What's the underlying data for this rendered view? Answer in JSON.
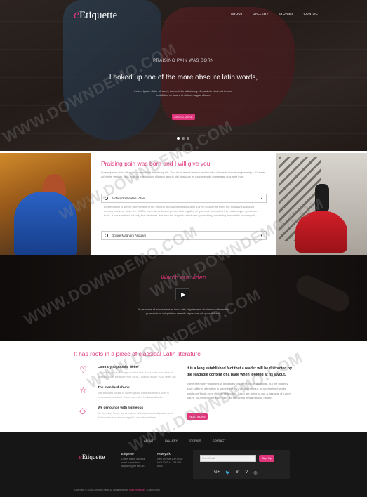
{
  "brand": {
    "logo_initial": "e",
    "logo_text": "Etiquette",
    "accent": "#e0357a"
  },
  "nav": [
    "ABOUT",
    "GALLERY",
    "STORIES",
    "CONTACT"
  ],
  "hero": {
    "kicker": "PRAISING PAIN WAS BORN",
    "title": "Looked up one of the more obscure latin words,",
    "subtitle_1": "Lorem ipsum dolor sit amet, consectetur adipiscing elit, sed do eiusmod tempor",
    "subtitle_2": "incididunt ut labore et dolore magna aliqua.",
    "button": "LEARN MORE",
    "slides": 3
  },
  "panel": {
    "title": "Praising pain was born and I will give you",
    "text": "Lorem ipsum dolor sit amet, consectetur adipiscing elit. Sed do eiusmod tempor incididunt ut labore et dolore magna aliqua. Ut enim ad minim veniam, quis nostrud exercitation ullamco laboris nisi ut aliquip ex ea commodo consequat duis aute irure.",
    "accordion": [
      {
        "label": "Architecto Beatae Vitae",
        "open": true
      },
      {
        "label": "Dolore Magnam Aliquam",
        "open": false
      }
    ],
    "accordion_body": "Lorem ipsum is simply dummy text of the printing and typesetting industry. Lorem Ipsum has been the industry's standard dummy text ever since the 1500s, when an unknown printer took a galley of type and scrambled it to make a type specimen book. It has survived not only five centuries, but also the leap into electronic typesetting, remaining essentially unchanged."
  },
  "video": {
    "title": "Watch our video",
    "play_icon": "play-icon",
    "text": "At vero eos et accusamus et iusto odio dignissimos ducimus qui blanditiis praesentium voluptatum deleniti atque corrupti quos dolores."
  },
  "features": {
    "title": "It has roots in a piece of classical Latin literature",
    "items": [
      {
        "icon": "heart-icon",
        "heading": "Contrary to popular belief",
        "text": "Lorem ipsum is not simply random text. It has roots in a piece of classical Latin literature from 45 BC, making it over 2000 years old."
      },
      {
        "icon": "star-icon",
        "heading": "The standard chunk",
        "text": "The standard chunk of Lorem Ipsum used since the 1500s is reproduced below for those interested in classical texts."
      },
      {
        "icon": "diamond-icon",
        "heading": "We denounce with righteous",
        "text": "On the other hand, we denounce with righteous indignation and dislike men who are so beguiled and demoralized."
      }
    ],
    "right_heading": "It is a long established fact that a reader will be distracted by the readable content of a page when looking at its layout.",
    "right_text": "There are many variations of passages of Lorem Ipsum available, but the majority have suffered alteration in some form, by injected humour, or randomised words which don't look even slightly believable. If you are going to use a passage of Lorem Ipsum, you need to be sure there isn't anything embarrassing hidden.",
    "button": "READ MORE"
  },
  "footer": {
    "nav": [
      "ABOUT",
      "GALLERY",
      "STORIES",
      "CONTACT"
    ],
    "col1_heading": "Etiquette",
    "col1_text": "Lorem ipsum dolor sit amet consectetur adipiscing elit sed do",
    "col2_heading": "New york",
    "col2_text": "Ravi Avenue 10th Floor, NY 10002 +1 234 567 8910",
    "email_placeholder": "Enter Email",
    "subscribe": "Sign Up",
    "social": [
      "G+",
      "🐦",
      "in",
      "V",
      "◎"
    ],
    "copyright_pre": "Copyright © 2016 Company name All rights reserved",
    "copyright_link": "More Templates",
    "copyright_post": "- Collect from"
  },
  "watermark": "WWW.DOWNDEMO.COM"
}
